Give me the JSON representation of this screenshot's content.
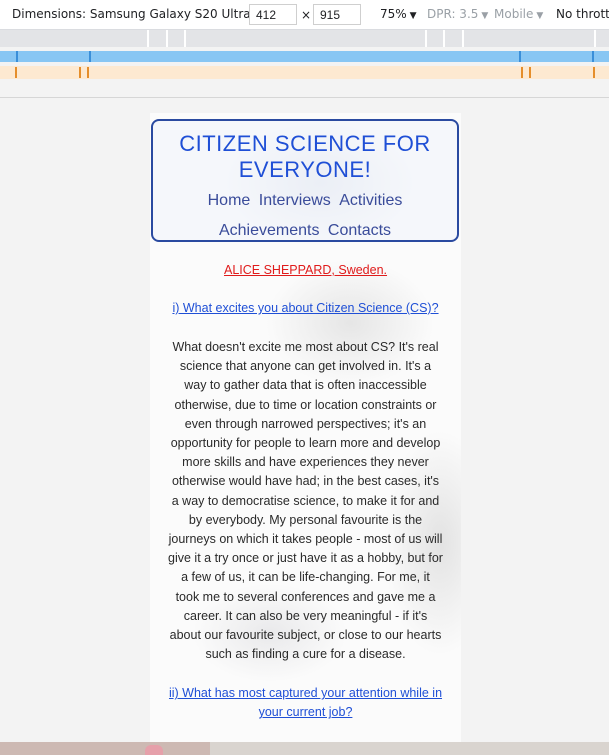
{
  "devtools": {
    "device_label": "Dimensions: Samsung Galaxy S20 Ultra",
    "width": "412",
    "times": "×",
    "height": "915",
    "zoom": "75%",
    "dpr": "DPR: 3.5",
    "mode": "Mobile",
    "throttle": "No throttl"
  },
  "site": {
    "title": "CITIZEN SCIENCE FOR EVERYONE!",
    "nav": [
      "Home",
      "Interviews",
      "Activities",
      "Achievements",
      "Contacts"
    ]
  },
  "article": {
    "author": "ALICE SHEPPARD, Sweden.",
    "question1": "i) What excites you about Citizen Science (CS)?",
    "answer1": "What doesn't excite me most about CS? It's real science that anyone can get involved in. It's a way to gather data that is often inaccessible otherwise, due to time or location constraints or even through narrowed perspectives; it's an opportunity for people to learn more and develop more skills and have experiences they never otherwise would have had; in the best cases, it's a way to democratise science, to make it for and by everybody. My personal favourite is the journeys on which it takes people - most of us will give it a try once or just have it as a hobby, but for a few of us, it can be life-changing. For me, it took me to several conferences and gave me a career. It can also be very meaningful - if it's about our favourite subject, or close to our hearts such as finding a cure for a disease.",
    "question2": "ii) What has most captured your attention while in your current job?"
  }
}
